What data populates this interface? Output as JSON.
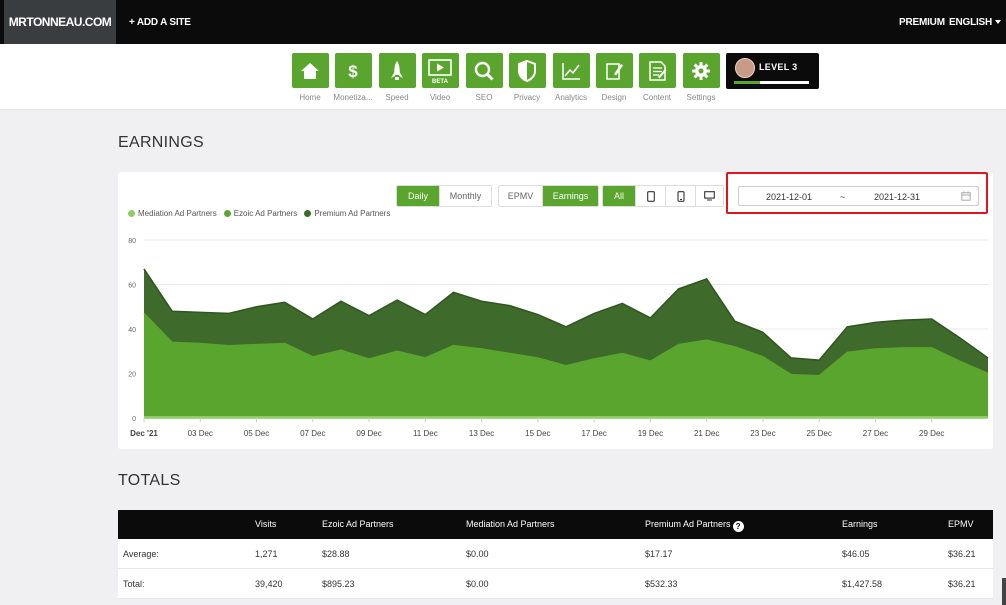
{
  "topbar": {
    "brand": "MRTONNEAU.COM",
    "add_site": "+ ADD A SITE",
    "premium": "PREMIUM",
    "language": "ENGLISH"
  },
  "nav": {
    "items": [
      {
        "label": "Home",
        "icon": "home-icon"
      },
      {
        "label": "Monetiza...",
        "icon": "dollar-icon"
      },
      {
        "label": "Speed",
        "icon": "rocket-icon"
      },
      {
        "label": "Video",
        "icon": "video-icon",
        "badge": "BETA"
      },
      {
        "label": "SEO",
        "icon": "magnifier-icon"
      },
      {
        "label": "Privacy",
        "icon": "shield-icon"
      },
      {
        "label": "Analytics",
        "icon": "line-chart-icon"
      },
      {
        "label": "Design",
        "icon": "design-icon"
      },
      {
        "label": "Content",
        "icon": "document-icon"
      },
      {
        "label": "Settings",
        "icon": "gear-icon"
      }
    ],
    "level": {
      "label": "LEVEL 3",
      "progress": 0.35
    }
  },
  "earnings": {
    "title": "EARNINGS",
    "period_buttons": [
      "Daily",
      "Monthly"
    ],
    "period_active": "Daily",
    "metric_buttons": [
      "EPMV",
      "Earnings"
    ],
    "metric_active": "Earnings",
    "device_all": "All",
    "device_icons": [
      "tablet-icon",
      "mobile-icon",
      "desktop-icon"
    ],
    "date_start": "2021-12-01",
    "date_separator": "~",
    "date_end": "2021-12-31",
    "colors": {
      "mediation": "#8fcb69",
      "ezoic": "#5aa52e",
      "premium": "#3e6a2b",
      "highlight": "#e0141e"
    }
  },
  "chart_data": {
    "type": "area",
    "stacked": true,
    "x": [
      "2021-12-01",
      "2021-12-02",
      "2021-12-03",
      "2021-12-04",
      "2021-12-05",
      "2021-12-06",
      "2021-12-07",
      "2021-12-08",
      "2021-12-09",
      "2021-12-10",
      "2021-12-11",
      "2021-12-12",
      "2021-12-13",
      "2021-12-14",
      "2021-12-15",
      "2021-12-16",
      "2021-12-17",
      "2021-12-18",
      "2021-12-19",
      "2021-12-20",
      "2021-12-21",
      "2021-12-22",
      "2021-12-23",
      "2021-12-24",
      "2021-12-25",
      "2021-12-26",
      "2021-12-27",
      "2021-12-28",
      "2021-12-29",
      "2021-12-30",
      "2021-12-31"
    ],
    "x_tick_labels": [
      "Dec '21",
      "03 Dec",
      "05 Dec",
      "07 Dec",
      "09 Dec",
      "11 Dec",
      "13 Dec",
      "15 Dec",
      "17 Dec",
      "19 Dec",
      "21 Dec",
      "23 Dec",
      "25 Dec",
      "27 Dec",
      "29 Dec"
    ],
    "y_ticks": [
      0,
      20,
      40,
      60,
      80
    ],
    "ylim": [
      0,
      80
    ],
    "grid": true,
    "legend_position": "top-left",
    "series": [
      {
        "name": "Mediation Ad Partners",
        "values": [
          0,
          0,
          0,
          0,
          0,
          0,
          0,
          0,
          0,
          0,
          0,
          0,
          0,
          0,
          0,
          0,
          0,
          0,
          0,
          0,
          0,
          0,
          0,
          0,
          0,
          0,
          0,
          0,
          0,
          0,
          0
        ]
      },
      {
        "name": "Ezoic Ad Partners",
        "values": [
          47,
          34,
          33.5,
          32.5,
          33,
          33.5,
          27.5,
          30.5,
          26.5,
          30,
          27,
          32.5,
          31,
          29,
          27,
          23.5,
          26.5,
          29,
          25.5,
          33,
          35,
          32,
          27.5,
          19.5,
          19,
          29.5,
          31,
          31.5,
          31.5,
          25.5,
          20
        ]
      },
      {
        "name": "Premium Ad Partners",
        "values": [
          20,
          14,
          14,
          14.5,
          17,
          18.5,
          17,
          22,
          19.5,
          23,
          19.5,
          24,
          21.5,
          21.5,
          19.5,
          17.5,
          20.5,
          22.5,
          19.5,
          25,
          27.5,
          11.5,
          11,
          7.5,
          7,
          11.5,
          12,
          12.5,
          13,
          10.5,
          7
        ]
      }
    ]
  },
  "totals": {
    "title": "TOTALS",
    "columns": [
      "",
      "Visits",
      "Ezoic Ad Partners",
      "Mediation Ad Partners",
      "Premium Ad Partners",
      "Earnings",
      "EPMV"
    ],
    "rows": [
      [
        "Average:",
        "1,271",
        "$28.88",
        "$0.00",
        "$17.17",
        "$46.05",
        "$36.21"
      ],
      [
        "Total:",
        "39,420",
        "$895.23",
        "$0.00",
        "$532.33",
        "$1,427.58",
        "$36.21"
      ]
    ]
  }
}
